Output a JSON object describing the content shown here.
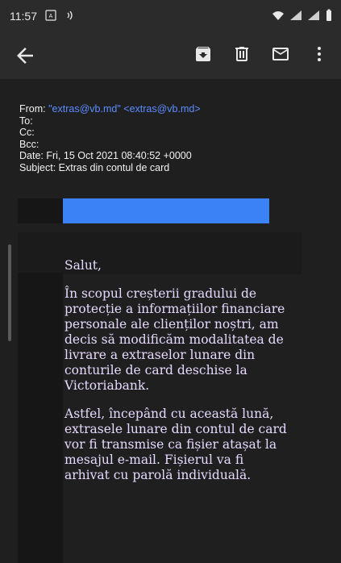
{
  "status_bar": {
    "time": "11:57"
  },
  "app_bar": {
    "icons": [
      "back-arrow-icon",
      "archive-icon",
      "delete-icon",
      "mail-icon",
      "more-vert-icon"
    ]
  },
  "email": {
    "from_label": "From:",
    "from_name_quoted": "\"extras@vb.md\"",
    "from_email": "<extras@vb.md>",
    "to_label": "To:",
    "cc_label": "Cc:",
    "bcc_label": "Bcc:",
    "date_line": "Date: Fri, 15 Oct 2021 08:40:52 +0000",
    "subject_line": "Subject: Extras din contul de card"
  },
  "body": {
    "greeting": "Salut,",
    "paragraph1": "În scopul creșterii gradului de protecție a informațiilor financiare personale ale clienților noștri, am decis să modificăm modalitatea de livrare a extraselor lunare din conturile de card deschise la Victoriabank.",
    "paragraph2": "Astfel, începând cu această lună, extrasele lunare din contul de card vor fi transmise ca fișier atașat la mesajul e-mail. Fișierul va fi arhivat cu parolă individuală."
  },
  "colors": {
    "accent": "#3b82f6",
    "link": "#5b8cff",
    "body_text": "#e7d9ff"
  }
}
